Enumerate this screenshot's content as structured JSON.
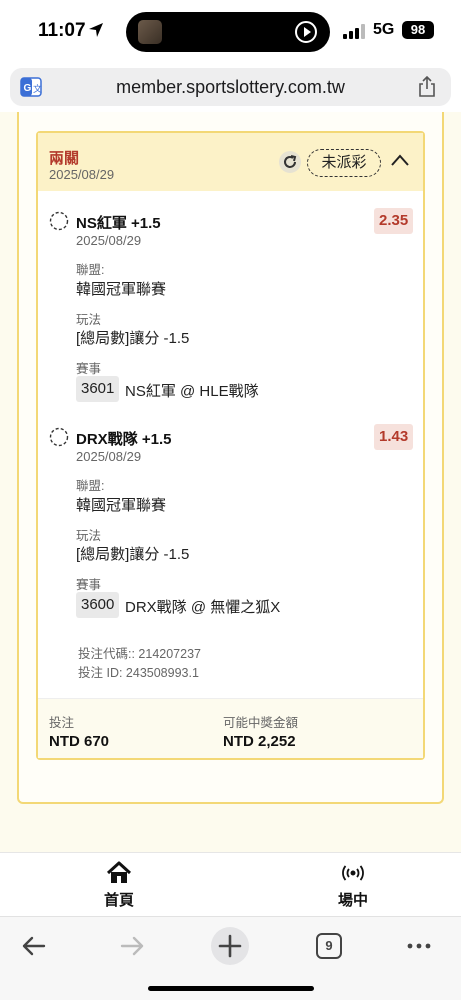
{
  "status_bar": {
    "time": "11:07",
    "network": "5G",
    "battery": "98"
  },
  "browser": {
    "url": "member.sportslottery.com.tw",
    "tabs_count": "9"
  },
  "bet": {
    "type": "兩關",
    "date": "2025/08/29",
    "status": "未派彩",
    "selections": [
      {
        "name": "NS紅軍 +1.5",
        "date": "2025/08/29",
        "odds": "2.35",
        "league_label": "聯盟:",
        "league": "韓國冠軍聯賽",
        "play_label": "玩法",
        "play": "[總局數]讓分 -1.5",
        "event_label": "賽事",
        "match_code": "3601",
        "match": "NS紅軍 @ HLE戰隊"
      },
      {
        "name": "DRX戰隊 +1.5",
        "date": "2025/08/29",
        "odds": "1.43",
        "league_label": "聯盟:",
        "league": "韓國冠軍聯賽",
        "play_label": "玩法",
        "play": "[總局數]讓分 -1.5",
        "event_label": "賽事",
        "match_code": "3600",
        "match": "DRX戰隊 @ 無懼之狐X"
      }
    ],
    "bet_code": "投注代碼:: 214207237",
    "bet_id": "投注 ID: 243508993.1",
    "stake_label": "投注",
    "stake": "NTD 670",
    "payout_label": "可能中獎金額",
    "payout": "NTD 2,252"
  },
  "bottom_nav": {
    "home": "首頁",
    "live": "場中"
  },
  "colors": {
    "accent_red": "#b33a2b",
    "card_border": "#f3d876",
    "header_bg": "#fcf2c8"
  }
}
